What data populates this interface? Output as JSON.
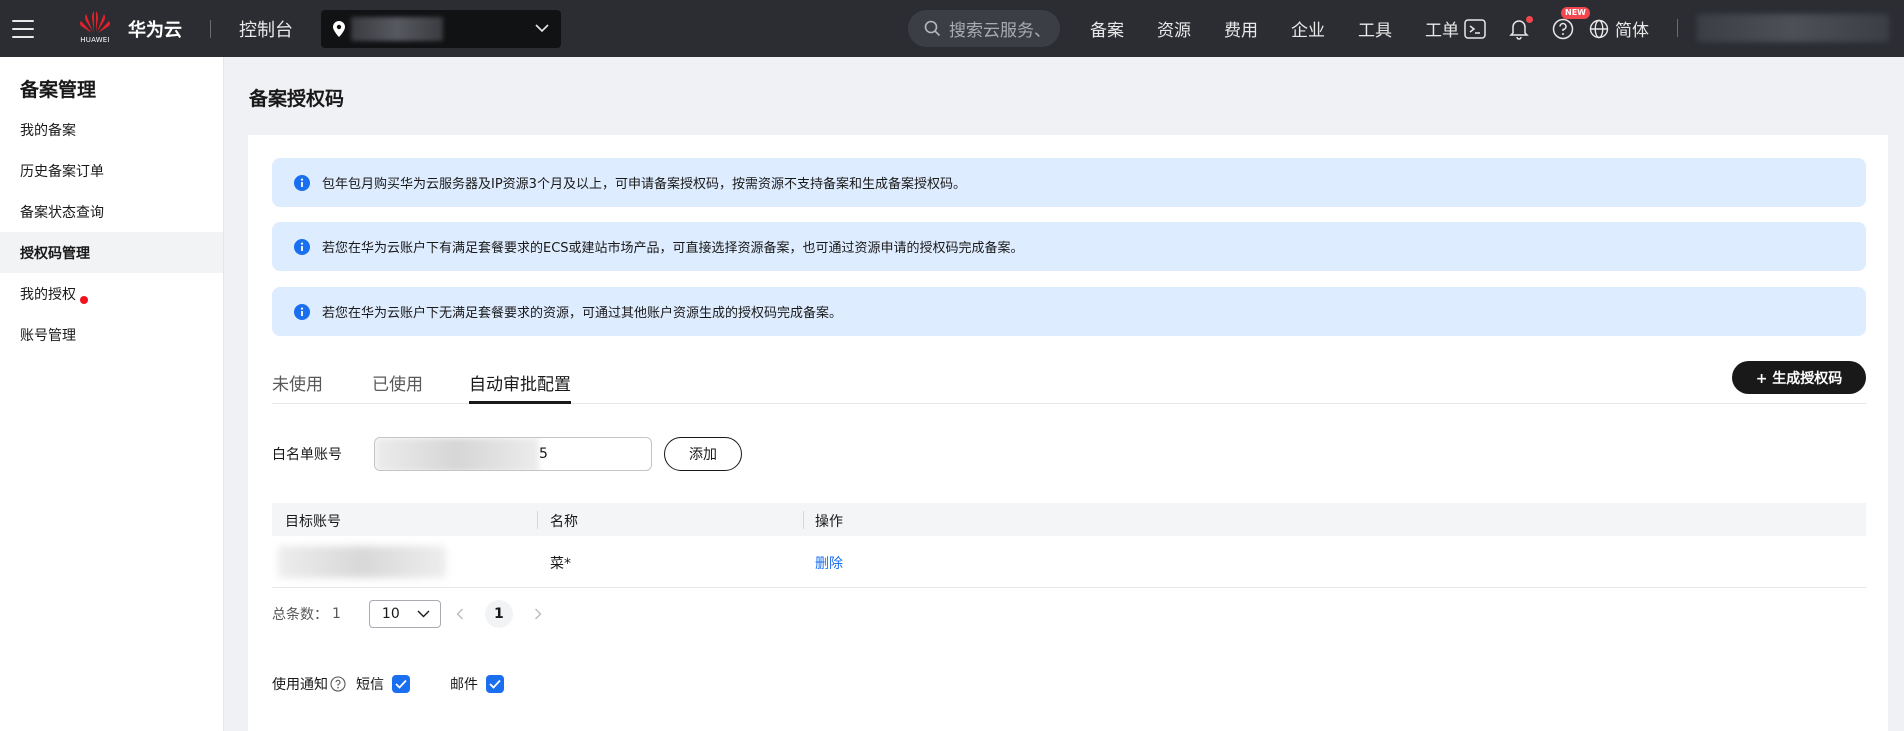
{
  "header": {
    "logo_text": "HUAWEI",
    "brand": "华为云",
    "console": "控制台",
    "search_placeholder": "搜索云服务、",
    "nav": [
      "备案",
      "资源",
      "费用",
      "企业",
      "工具",
      "工单"
    ],
    "new_badge": "NEW",
    "language": "简体"
  },
  "sidebar": {
    "title": "备案管理",
    "items": [
      {
        "label": "我的备案"
      },
      {
        "label": "历史备案订单"
      },
      {
        "label": "备案状态查询"
      },
      {
        "label": "授权码管理",
        "active": true
      },
      {
        "label": "我的授权",
        "dot": true
      },
      {
        "label": "账号管理"
      }
    ]
  },
  "main": {
    "title": "备案授权码",
    "notices": [
      "包年包月购买华为云服务器及IP资源3个月及以上，可申请备案授权码，按需资源不支持备案和生成备案授权码。",
      "若您在华为云账户下有满足套餐要求的ECS或建站市场产品，可直接选择资源备案，也可通过资源申请的授权码完成备案。",
      "若您在华为云账户下无满足套餐要求的资源，可通过其他账户资源生成的授权码完成备案。"
    ],
    "tabs": [
      "未使用",
      "已使用",
      "自动审批配置"
    ],
    "active_tab": 2,
    "generate_button": "+ 生成授权码",
    "whitelist": {
      "label": "白名单账号",
      "value_suffix": "5",
      "add_button": "添加"
    },
    "table": {
      "headers": [
        "目标账号",
        "名称",
        "操作"
      ],
      "rows": [
        {
          "name": "菜*",
          "action": "删除"
        }
      ]
    },
    "pagination": {
      "total_label": "总条数：",
      "total": "1",
      "page_size": "10",
      "current_page": "1"
    },
    "notify": {
      "label": "使用通知",
      "sms_label": "短信",
      "sms_checked": true,
      "email_label": "邮件",
      "email_checked": true
    }
  },
  "colors": {
    "topbar": "#2b2d33",
    "notice_bg": "#deecff",
    "link": "#1a6ef0",
    "badge_red": "#f2474e",
    "primary_button": "#191919"
  }
}
